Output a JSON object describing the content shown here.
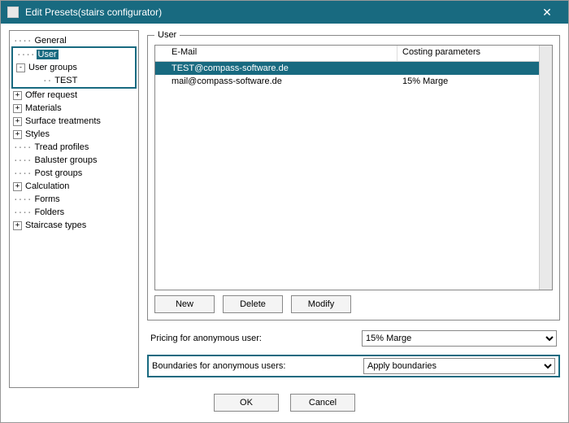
{
  "window": {
    "title": "Edit Presets(stairs configurator)"
  },
  "tree": {
    "items": [
      {
        "label": "General",
        "expander": "dots"
      },
      {
        "label": "User",
        "expander": "dots",
        "selected": true
      },
      {
        "label": "User groups",
        "expander": "minus"
      },
      {
        "label": "TEST",
        "expander": "dots",
        "depth": 2
      },
      {
        "label": "Offer request",
        "expander": "plus"
      },
      {
        "label": "Materials",
        "expander": "plus"
      },
      {
        "label": "Surface treatments",
        "expander": "plus"
      },
      {
        "label": "Styles",
        "expander": "plus"
      },
      {
        "label": "Tread profiles",
        "expander": "dots"
      },
      {
        "label": "Baluster groups",
        "expander": "dots"
      },
      {
        "label": "Post groups",
        "expander": "dots"
      },
      {
        "label": "Calculation",
        "expander": "plus"
      },
      {
        "label": "Forms",
        "expander": "dots"
      },
      {
        "label": "Folders",
        "expander": "dots"
      },
      {
        "label": "Staircase types",
        "expander": "plus"
      }
    ]
  },
  "user_group": {
    "legend": "User",
    "columns": {
      "email": "E-Mail",
      "costing": "Costing parameters"
    },
    "rows": [
      {
        "email": "TEST@compass-software.de",
        "costing": "",
        "selected": true
      },
      {
        "email": "mail@compass-software.de",
        "costing": "15% Marge",
        "selected": false
      }
    ],
    "buttons": {
      "new": "New",
      "delete": "Delete",
      "modify": "Modify"
    }
  },
  "pricing": {
    "label": "Pricing for anonymous user:",
    "value": "15% Marge"
  },
  "boundaries": {
    "label": "Boundaries for anonymous users:",
    "value": "Apply boundaries"
  },
  "dialog_buttons": {
    "ok": "OK",
    "cancel": "Cancel"
  }
}
